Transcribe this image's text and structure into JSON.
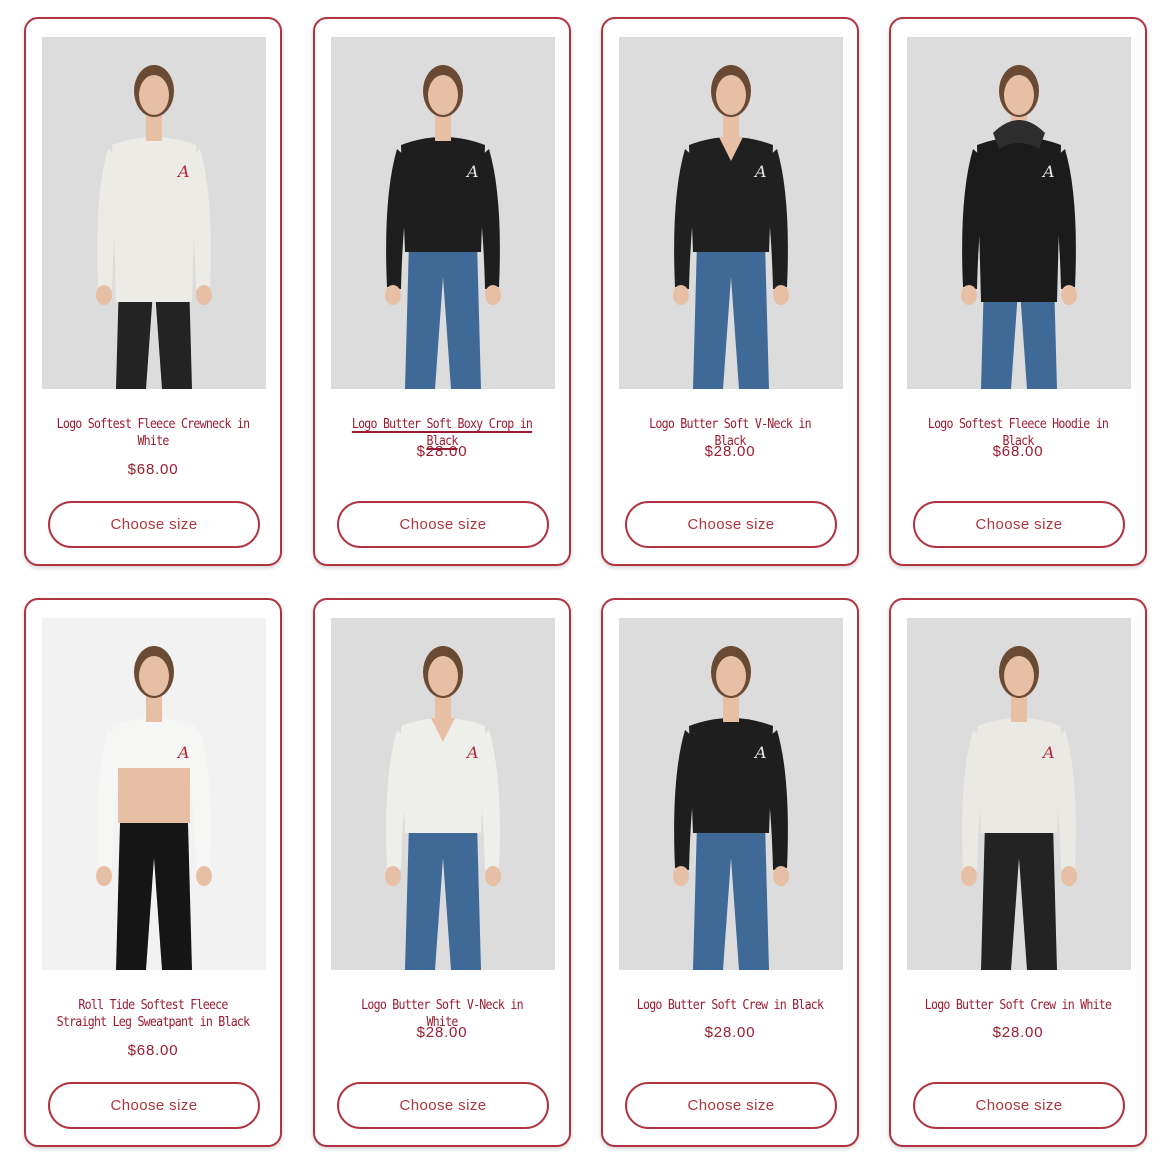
{
  "colors": {
    "accent": "#b0343f",
    "title_text": "#9b1b30",
    "photo_background": "#dcdcdc"
  },
  "products": [
    {
      "title": "Logo Softest Fleece Crewneck in White",
      "price": "$68.00",
      "button_label": "Choose size",
      "garment": "white-crewneck",
      "pants": "black-leggings",
      "title_lines": 2
    },
    {
      "title": "Logo Butter Soft Boxy Crop in Black",
      "price": "$28.00",
      "button_label": "Choose size",
      "garment": "black-tee",
      "pants": "blue-jeans",
      "title_lines": 1,
      "hovered": true
    },
    {
      "title": "Logo Butter Soft V-Neck in Black",
      "price": "$28.00",
      "button_label": "Choose size",
      "garment": "black-vneck",
      "pants": "blue-jeans",
      "title_lines": 1
    },
    {
      "title": "Logo Softest Fleece Hoodie in Black",
      "price": "$68.00",
      "button_label": "Choose size",
      "garment": "black-hoodie",
      "pants": "blue-jeans",
      "title_lines": 1
    },
    {
      "title": "Roll Tide Softest Fleece Straight Leg Sweatpant in Black",
      "price": "$68.00",
      "button_label": "Choose size",
      "garment": "white-crop",
      "pants": "black-sweatpants",
      "title_lines": 2
    },
    {
      "title": "Logo Butter Soft V-Neck in White",
      "price": "$28.00",
      "button_label": "Choose size",
      "garment": "white-vneck",
      "pants": "blue-jeans",
      "title_lines": 1
    },
    {
      "title": "Logo Butter Soft Crew in Black",
      "price": "$28.00",
      "button_label": "Choose size",
      "garment": "black-tee",
      "pants": "blue-jeans",
      "title_lines": 1
    },
    {
      "title": "Logo Butter Soft Crew in White",
      "price": "$28.00",
      "button_label": "Choose size",
      "garment": "white-tee",
      "pants": "black-leggings",
      "title_lines": 1
    }
  ]
}
